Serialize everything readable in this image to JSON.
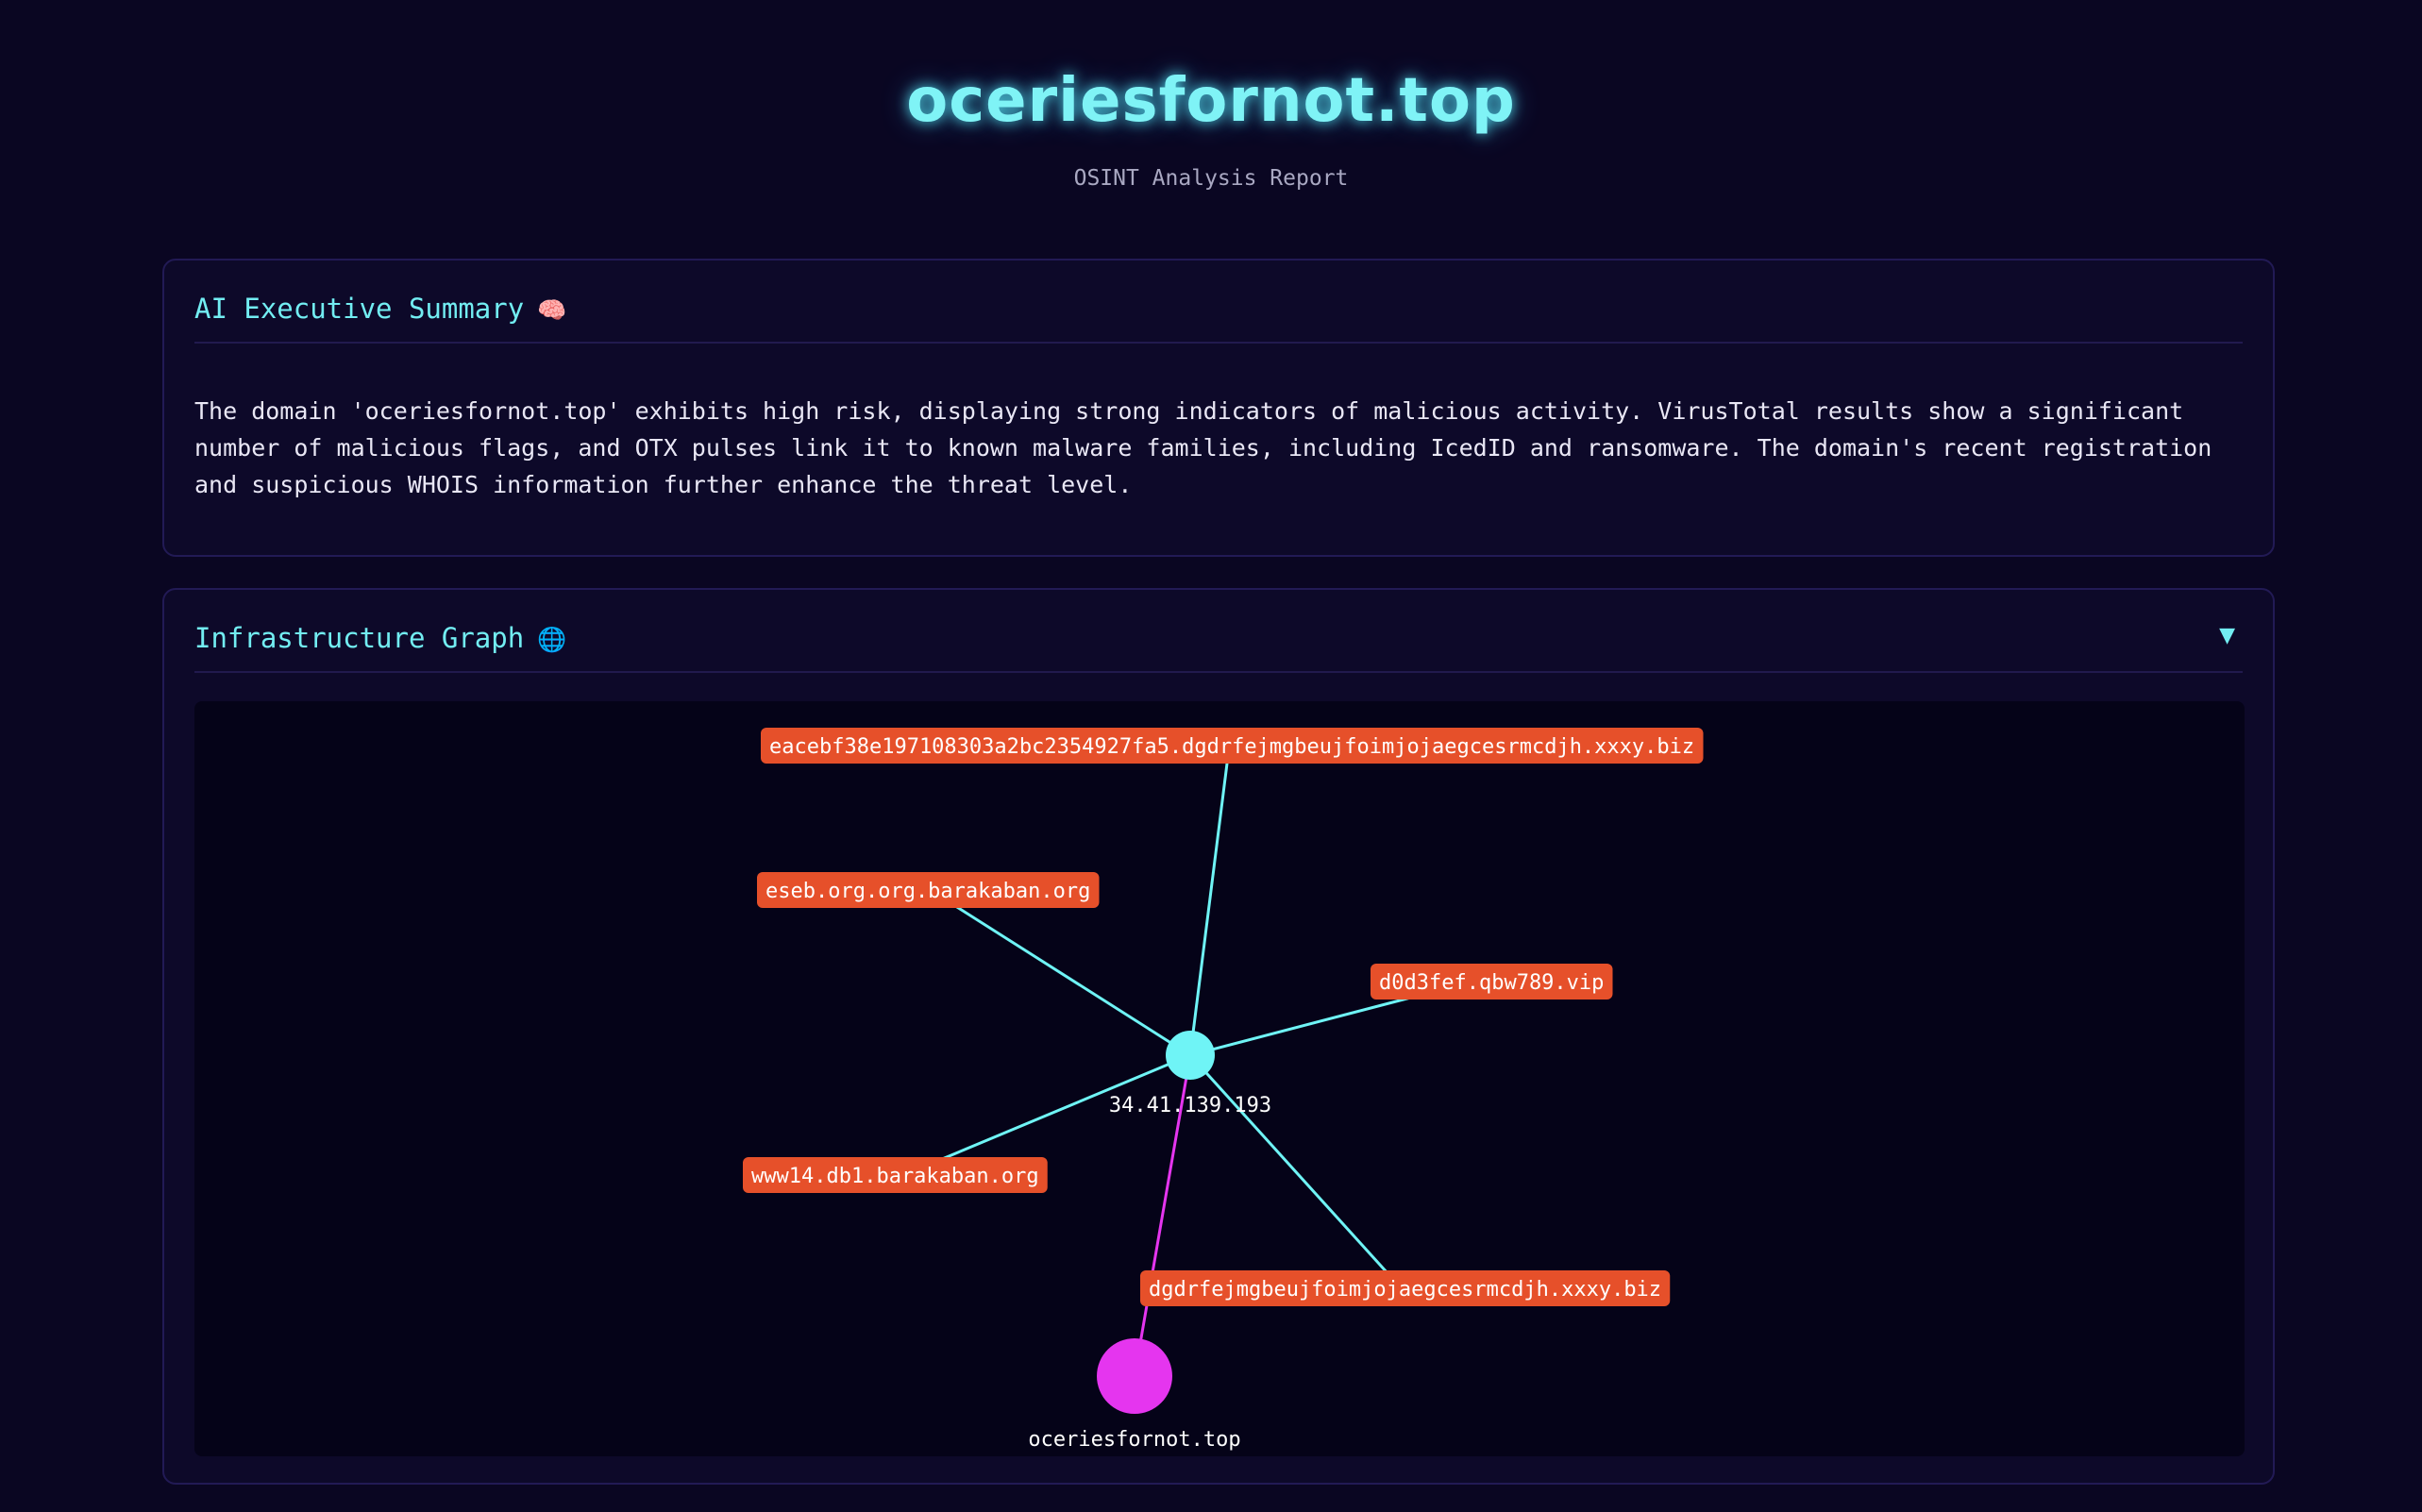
{
  "header": {
    "title": "oceriesfornot.top",
    "subtitle": "OSINT Analysis Report"
  },
  "summary": {
    "title": "AI Executive Summary",
    "icon": "brain-icon",
    "emoji": "🧠",
    "text": "The domain 'oceriesfornot.top' exhibits high risk, displaying strong indicators of malicious activity. VirusTotal results show a significant number of malicious flags, and OTX pulses link it to known malware families, including IcedID and ransomware. The domain's recent registration and suspicious WHOIS information further enhance the threat level."
  },
  "graph": {
    "title": "Infrastructure Graph",
    "icon": "globe-icon",
    "emoji": "🌐",
    "collapse_symbol": "▼",
    "colors": {
      "subdomain_fill": "#e6502a",
      "ip_node": "#6ff4f6",
      "domain_node": "#e535ef",
      "edge_ip": "#6ff4f6",
      "edge_domain": "#e535ef"
    },
    "ip": "34.41.139.193",
    "domain": "oceriesfornot.top",
    "subdomains": [
      "eacebf38e197108303a2bc2354927fa5.dgdrfejmgbeujfoimjojaegcesrmcdjh.xxxy.biz",
      "eseb.org.org.barakaban.org",
      "d0d3fef.qbw789.vip",
      "www14.db1.barakaban.org",
      "dgdrfejmgbeujfoimjojaegcesrmcdjh.xxxy.biz"
    ]
  }
}
